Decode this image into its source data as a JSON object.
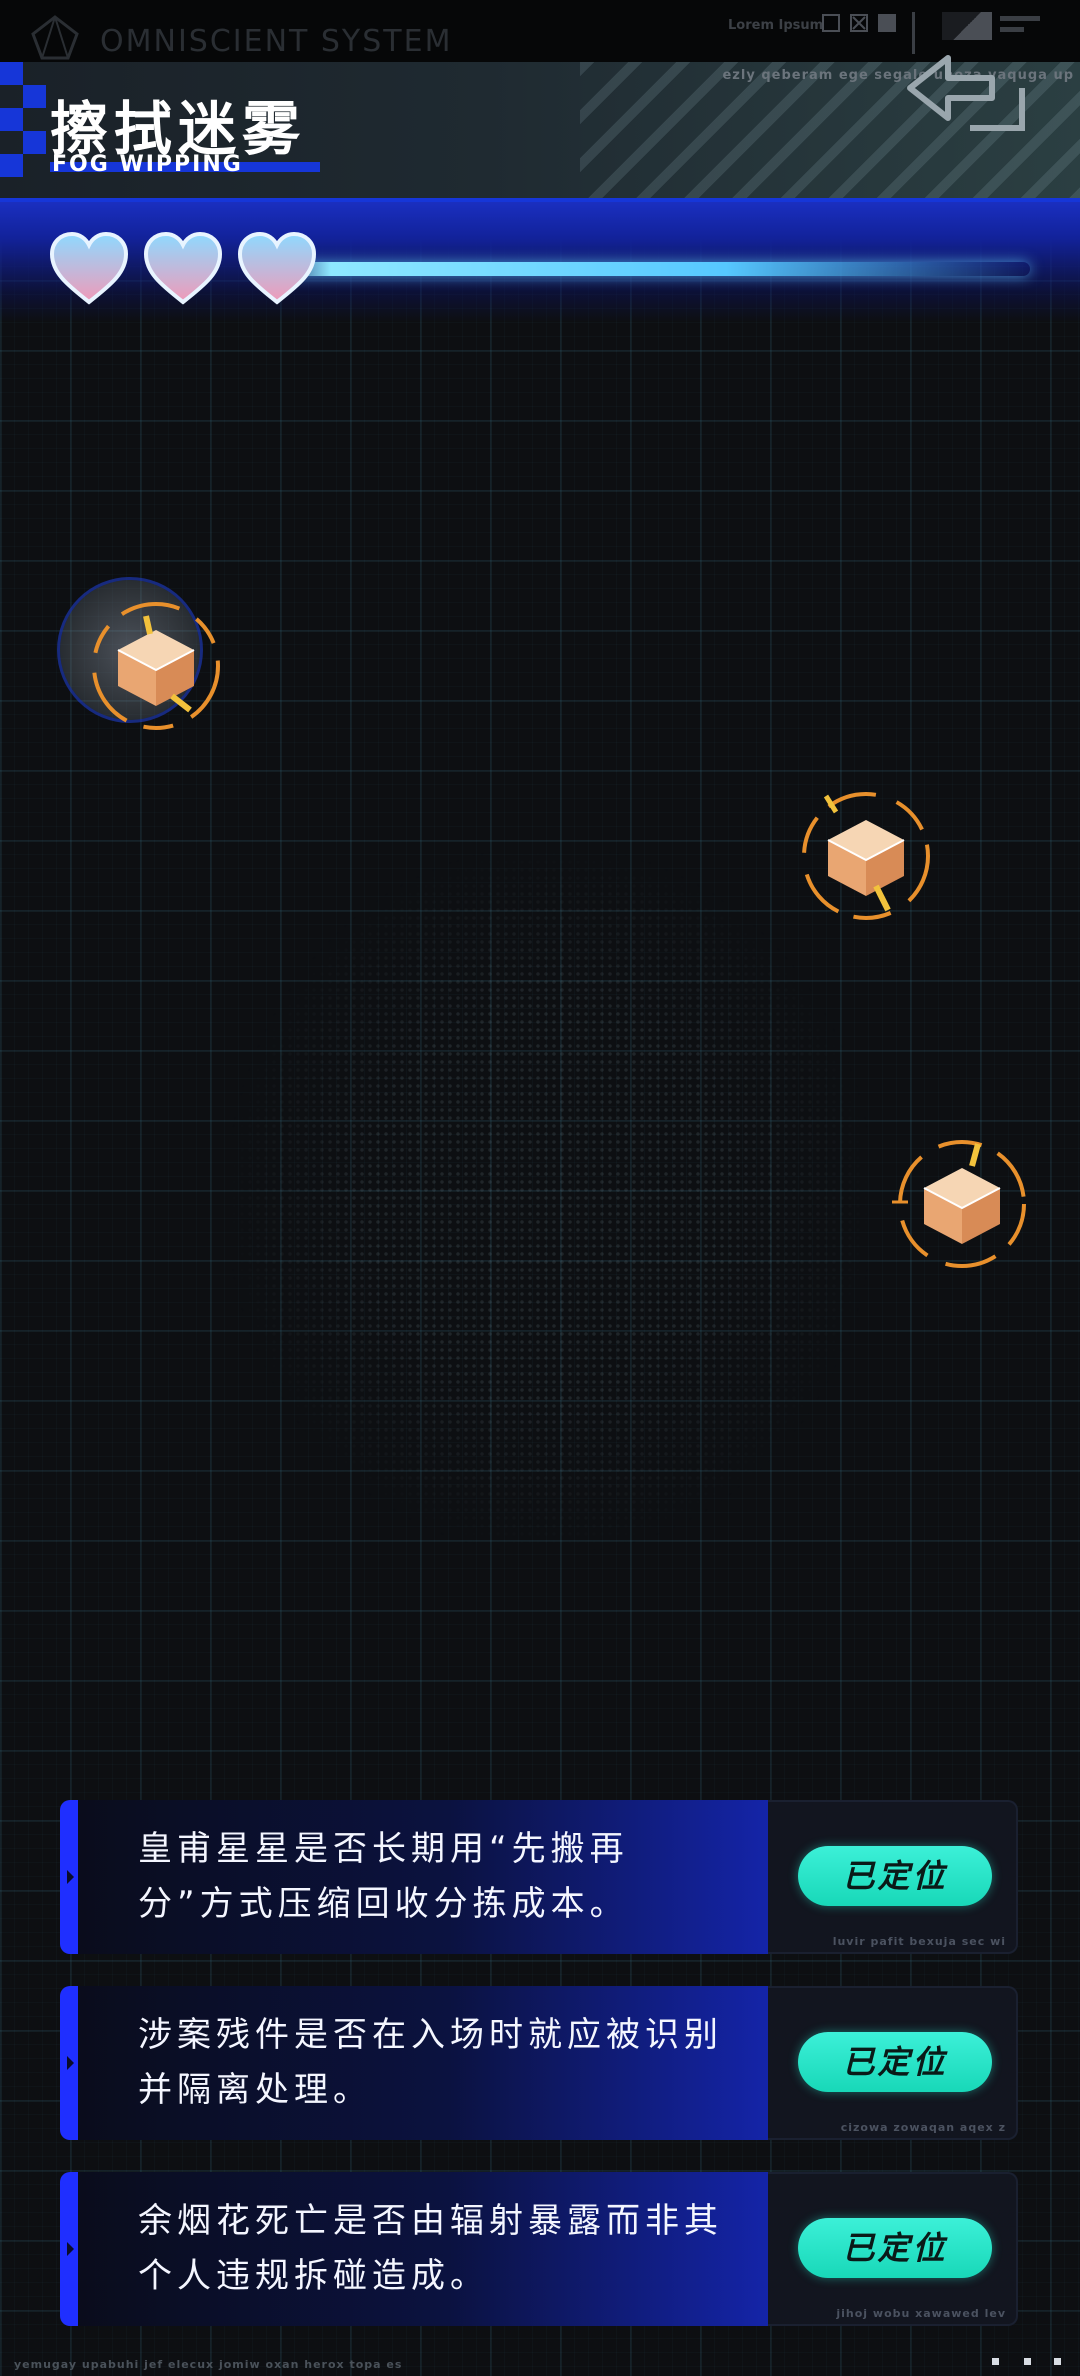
{
  "topbar": {
    "system_name": "OMNISCIENT SYSTEM",
    "lorem_label": "Lorem Ipsum"
  },
  "header": {
    "title_cn": "擦拭迷雾",
    "title_en": "FOG WIPPING",
    "caption": "ezly qeberam ege segale unoza vaquga up"
  },
  "lives": {
    "count": 3,
    "max": 3
  },
  "targets": [
    {
      "name": "supply-crate-1",
      "state": "selected"
    },
    {
      "name": "supply-crate-2",
      "state": "idle"
    },
    {
      "name": "supply-crate-3",
      "state": "idle"
    }
  ],
  "questions": [
    {
      "line1": "皇甫星星是否长期用“先搬再",
      "line2": "分”方式压缩回收分拣成本。",
      "status_label": "已定位",
      "caption": "luvir pafit bexuja sec wi"
    },
    {
      "line1": "涉案残件是否在入场时就应被识别",
      "line2": "并隔离处理。",
      "status_label": "已定位",
      "caption": "cizowa zowaqan aqex z"
    },
    {
      "line1": "余烟花死亡是否由辐射暴露而非其",
      "line2": "个人违规拆碰造成。",
      "status_label": "已定位",
      "caption": "jihoj wobu xawawed lev"
    }
  ],
  "footer": {
    "text": "yemugay upabuhi jef elecux jomiw oxan herox topa es"
  },
  "colors": {
    "accent_blue": "#1636d8",
    "located_teal": "#23e3c4",
    "crate_orange": "#e8902c",
    "heart_top": "#8fd9ff",
    "heart_bottom": "#f09ab8"
  }
}
